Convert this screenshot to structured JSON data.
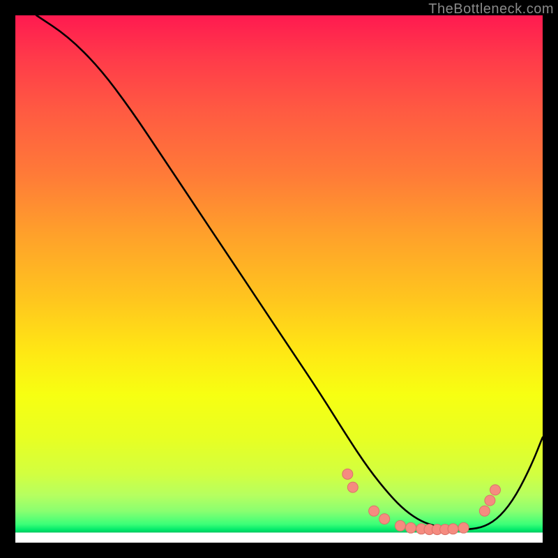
{
  "watermark": "TheBottleneck.com",
  "colors": {
    "frame": "#000000",
    "curve": "#000000",
    "dot_fill": "#f58b80",
    "dot_stroke": "#d97268",
    "gradient_top": "#ff1a50",
    "gradient_bottom_band": "#00e86a"
  },
  "chart_data": {
    "type": "line",
    "title": "",
    "xlabel": "",
    "ylabel": "",
    "xlim": [
      0,
      100
    ],
    "ylim": [
      0,
      100
    ],
    "grid": false,
    "legend": false,
    "note": "Axes are unlabeled in source; values are percent-of-plot positions read off by eye.",
    "series": [
      {
        "name": "curve",
        "x": [
          4,
          10,
          16,
          22,
          28,
          34,
          40,
          46,
          52,
          58,
          63,
          67,
          71,
          74,
          77,
          80,
          83,
          86,
          89,
          92,
          95,
          98,
          100
        ],
        "y": [
          100,
          96,
          90,
          82,
          73,
          64,
          55,
          46,
          37,
          28,
          20,
          14,
          9,
          6,
          4,
          3,
          2.5,
          2.5,
          3,
          5,
          9,
          15,
          20
        ]
      }
    ],
    "dots": [
      {
        "x": 63,
        "y": 13.0
      },
      {
        "x": 64,
        "y": 10.5
      },
      {
        "x": 68,
        "y": 6.0
      },
      {
        "x": 70,
        "y": 4.5
      },
      {
        "x": 73,
        "y": 3.2
      },
      {
        "x": 75,
        "y": 2.8
      },
      {
        "x": 77,
        "y": 2.6
      },
      {
        "x": 78.5,
        "y": 2.5
      },
      {
        "x": 80,
        "y": 2.5
      },
      {
        "x": 81.5,
        "y": 2.5
      },
      {
        "x": 83,
        "y": 2.6
      },
      {
        "x": 85,
        "y": 2.8
      },
      {
        "x": 89,
        "y": 6.0
      },
      {
        "x": 90,
        "y": 8.0
      },
      {
        "x": 91,
        "y": 10.0
      }
    ]
  }
}
